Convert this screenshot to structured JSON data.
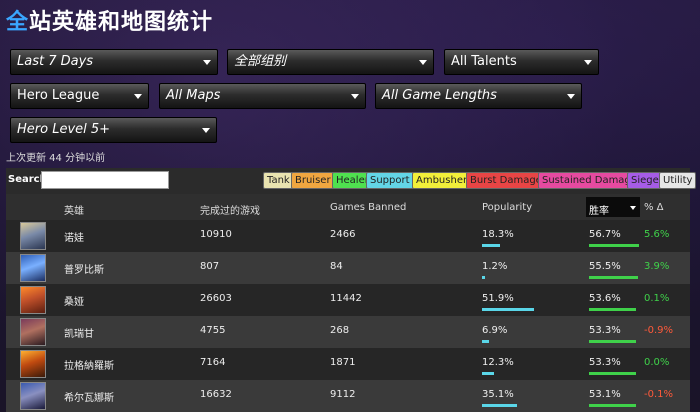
{
  "page": {
    "title_first": "全",
    "title_rest": "站英雄和地图统计"
  },
  "filters": {
    "time": "Last 7 Days",
    "group": "全部组别",
    "talents": "All Talents",
    "league": "Hero League",
    "maps": "All Maps",
    "lengths": "All Game Lengths",
    "level": "Hero Level 5+"
  },
  "updated": "上次更新 44 分钟以前",
  "search": {
    "label": "Search:",
    "placeholder": "",
    "value": ""
  },
  "roles": [
    {
      "label": "Tank",
      "color": "#e9e3b0"
    },
    {
      "label": "Bruiser",
      "color": "#f0a640"
    },
    {
      "label": "Healer",
      "color": "#4fe04f"
    },
    {
      "label": "Support",
      "color": "#63d5e6"
    },
    {
      "label": "Ambusher",
      "color": "#f2ef3a"
    },
    {
      "label": "Burst Damage",
      "color": "#e84545"
    },
    {
      "label": "Sustained Damage",
      "color": "#e64aa0"
    },
    {
      "label": "Siege",
      "color": "#a65ce6"
    },
    {
      "label": "Utility",
      "color": "#e6e6e6"
    }
  ],
  "columns": {
    "hero": "英雄",
    "games": "完成过的游戏",
    "banned": "Games Banned",
    "popularity": "Popularity",
    "winrate": "胜率",
    "delta": "% Δ"
  },
  "rows": [
    {
      "name": "诺娃",
      "games": "10910",
      "banned": "2466",
      "popularity": "18.3%",
      "pop": 0.183,
      "winrate": "56.7%",
      "win": 0.567,
      "delta": "5.6%",
      "delta_color": "#3fd14a",
      "avatar": "nova-portrait"
    },
    {
      "name": "普罗比斯",
      "games": "807",
      "banned": "84",
      "popularity": "1.2%",
      "pop": 0.012,
      "winrate": "55.5%",
      "win": 0.555,
      "delta": "3.9%",
      "delta_color": "#3fd14a",
      "avatar": "probius-portrait"
    },
    {
      "name": "桑娅",
      "games": "26603",
      "banned": "11442",
      "popularity": "51.9%",
      "pop": 0.519,
      "winrate": "53.6%",
      "win": 0.536,
      "delta": "0.1%",
      "delta_color": "#3fd14a",
      "avatar": "sonya-portrait"
    },
    {
      "name": "凯瑞甘",
      "games": "4755",
      "banned": "268",
      "popularity": "6.9%",
      "pop": 0.069,
      "winrate": "53.3%",
      "win": 0.533,
      "delta": "-0.9%",
      "delta_color": "#ff5a3a",
      "avatar": "kerrigan-portrait"
    },
    {
      "name": "拉格納羅斯",
      "games": "7164",
      "banned": "1871",
      "popularity": "12.3%",
      "pop": 0.123,
      "winrate": "53.3%",
      "win": 0.533,
      "delta": "0.0%",
      "delta_color": "#3fd14a",
      "avatar": "ragnaros-portrait"
    },
    {
      "name": "希尔瓦娜斯",
      "games": "16632",
      "banned": "9112",
      "popularity": "35.1%",
      "pop": 0.351,
      "winrate": "53.1%",
      "win": 0.531,
      "delta": "-0.1%",
      "delta_color": "#ff5a3a",
      "avatar": "sylvanas-portrait"
    }
  ]
}
